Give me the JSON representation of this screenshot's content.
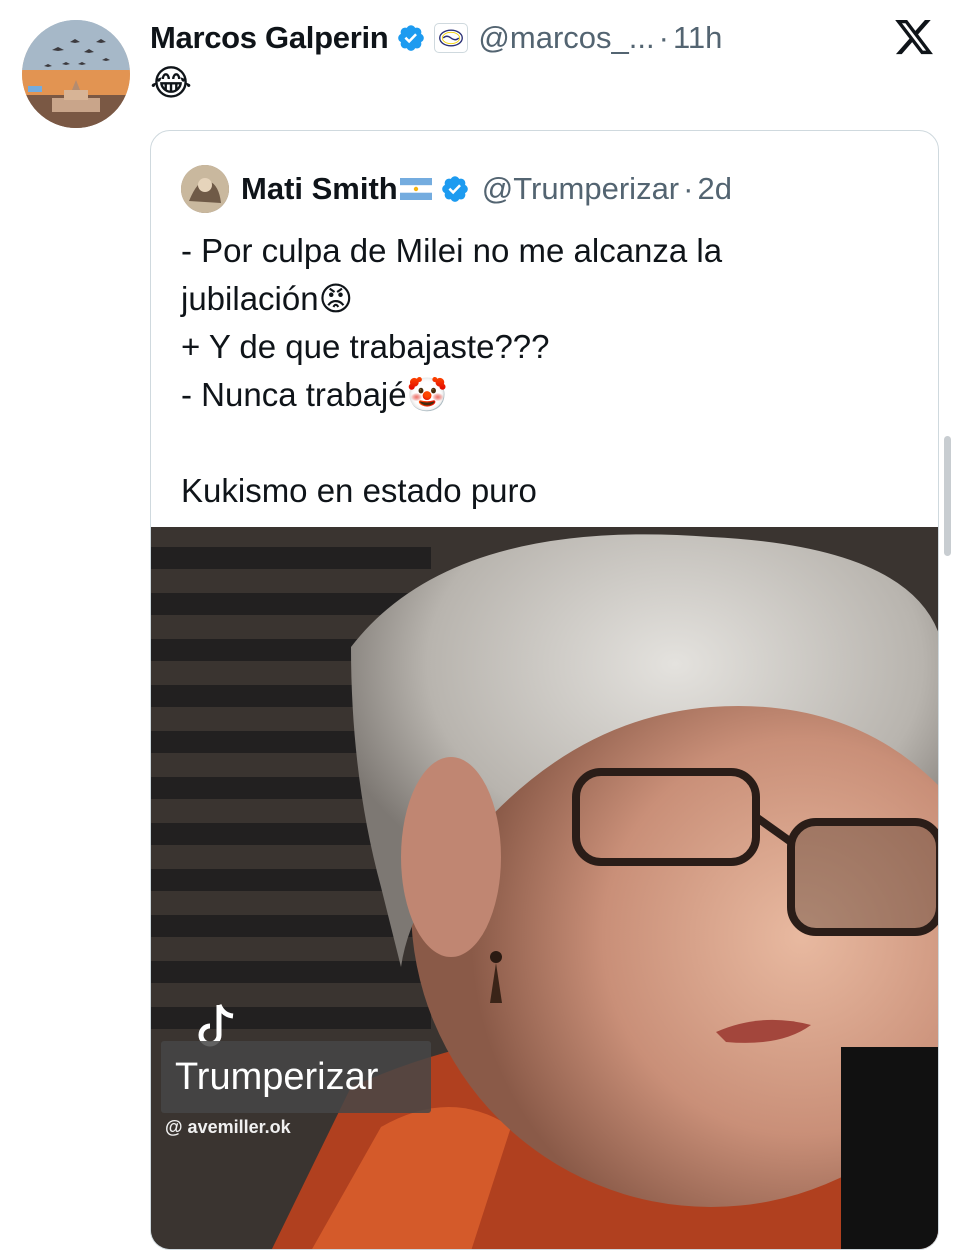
{
  "tweet": {
    "author_name": "Marcos Galperin",
    "handle": "@marcos_...",
    "separator": "·",
    "time": "11h",
    "text": "😂"
  },
  "quote": {
    "author_name": "Mati Smith",
    "handle": "@Trumperizar",
    "separator": "·",
    "time": "2d",
    "lines": [
      "- Por culpa de Milei no me alcanza la",
      "jubilación😡",
      "+ Y de que trabajaste???",
      "- Nunca trabajé🤡",
      "",
      "Kukismo en estado puro"
    ]
  },
  "media": {
    "overlay_title": "Trumperizar",
    "overlay_sub": "@ avemiller.ok"
  },
  "icons": {
    "verified": "verified-badge-icon",
    "affiliation": "affiliation-badge-icon",
    "platform": "x-logo-icon",
    "flag": "argentina-flag-icon",
    "watermark": "tiktok-icon"
  },
  "colors": {
    "verified_blue": "#1d9bf0",
    "secondary_text": "#536471",
    "border": "#cfd9de"
  }
}
